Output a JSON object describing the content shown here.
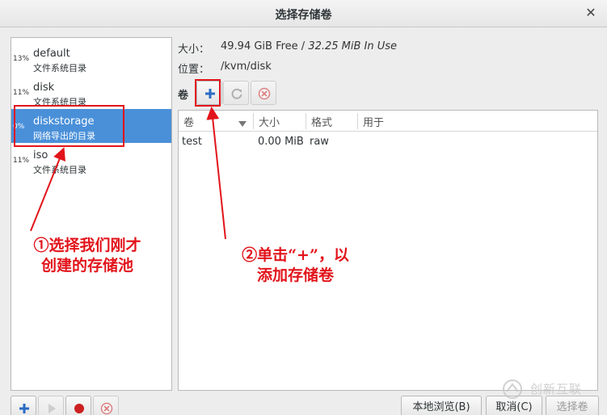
{
  "window": {
    "title": "选择存储卷"
  },
  "pools": [
    {
      "pct": "13%",
      "name": "default",
      "type": "文件系统目录",
      "selected": false
    },
    {
      "pct": "11%",
      "name": "disk",
      "type": "文件系统目录",
      "selected": false
    },
    {
      "pct": "0%",
      "name": "diskstorage",
      "type": "网络导出的目录",
      "selected": true
    },
    {
      "pct": "11%",
      "name": "iso",
      "type": "文件系统目录",
      "selected": false
    }
  ],
  "details": {
    "size_label": "大小：",
    "size_free": "49.94 GiB Free",
    "size_sep": " / ",
    "size_used": "32.25 MiB In Use",
    "location_label": "位置：",
    "location_value": "/kvm/disk",
    "volumes_label": "卷"
  },
  "table": {
    "columns": [
      "卷",
      "大小",
      "格式",
      "用于"
    ],
    "rows": [
      {
        "name": "test",
        "size": "0.00 MiB",
        "format": "raw",
        "used_by": ""
      }
    ]
  },
  "buttons": {
    "browse_local": "本地浏览(B)",
    "cancel": "取消(C)",
    "choose": "选择卷"
  },
  "annotations": {
    "step1_line1": "①选择我们刚才",
    "step1_line2": "创建的存储池",
    "step2_line1": "②单击“+”，以",
    "step2_line2": "添加存储卷"
  },
  "watermark": {
    "text": "创新互联"
  },
  "colors": {
    "selection": "#4a90d9",
    "annotation": "#e2141b"
  }
}
